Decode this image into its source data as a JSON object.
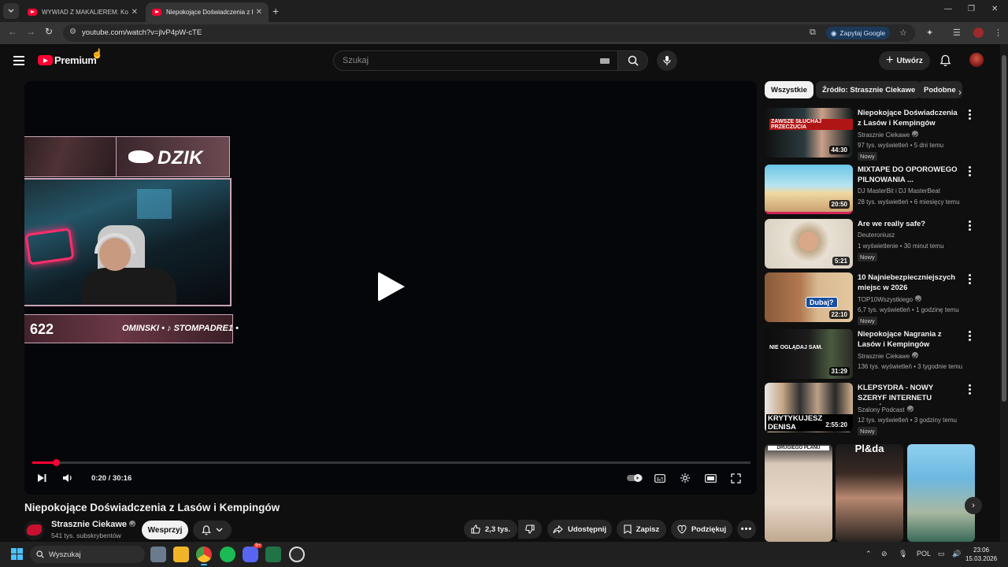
{
  "browser": {
    "tabs": [
      {
        "title": "WYWIAD Z MAKALIEREM: Kon",
        "active": false
      },
      {
        "title": "Niepokojące Doświadczenia z L",
        "active": true
      }
    ],
    "url": "youtube.com/watch?v=jlvP4pW-cTE",
    "ask_google_label": "Zapytaj Google",
    "accent_color": "#ff0033"
  },
  "masthead": {
    "logo_text": "Premium",
    "search_placeholder": "Szukaj",
    "create_label": "Utwórz"
  },
  "player": {
    "overlay_brand": "DZIK",
    "overlay_number": "622",
    "overlay_socials": "OMINSKI • ♪ STOMPADRE1 •",
    "time": "0:20 / 30:16",
    "progress_fraction": 0.011
  },
  "video": {
    "title": "Niepokojące Doświadczenia z Lasów i Kempingów",
    "channel": "Strasznie Ciekawe",
    "subscribers": "541 tys. subskrybentów",
    "support_label": "Wesprzyj",
    "likes": "2,3 tys.",
    "share_label": "Udostępnij",
    "save_label": "Zapisz",
    "thanks_label": "Podziękuj"
  },
  "sidebar": {
    "chips": [
      "Wszystkie",
      "Źródło: Strasznie Ciekawe",
      "Podobne"
    ],
    "recommendations": [
      {
        "title": "Niepokojące Doświadczenia z Lasów i Kempingów",
        "channel": "Strasznie Ciekawe",
        "verified": true,
        "meta": "97 tys. wyświetleń • 5 dni temu",
        "badge": "Nowy",
        "duration": "44:30",
        "thumb_text": "ZAWSZE SŁUCHAJ PRZECZUCIA"
      },
      {
        "title": "MIXTAPE DO OPOROWEGO PILNOWANIA ...",
        "channel": "DJ MasterBit i DJ MasterBeat",
        "verified": false,
        "meta": "28 tys. wyświetleń • 6 miesięcy temu",
        "badge": "",
        "duration": "20:50",
        "thumb_text": ""
      },
      {
        "title": "Are we really safe?",
        "channel": "Deuteroniusz",
        "verified": false,
        "meta": "1 wyświetlenie • 30 minut temu",
        "badge": "Nowy",
        "duration": "5:21",
        "thumb_text": ""
      },
      {
        "title": "10 Najniebezpieczniejszych miejsc w 2026",
        "channel": "TOP10Wszystkiego",
        "verified": true,
        "meta": "6,7 tys. wyświetleń • 1 godzinę temu",
        "badge": "Nowy",
        "duration": "22:10",
        "thumb_text": "Dubaj?"
      },
      {
        "title": "Niepokojące Nagrania z Lasów i Kempingów",
        "channel": "Strasznie Ciekawe",
        "verified": true,
        "meta": "136 tys. wyświetleń • 3 tygodnie temu",
        "badge": "",
        "duration": "31:29",
        "thumb_text": "NIE OGLĄDAJ SAM."
      },
      {
        "title": "KLEPSYDRA - NOWY SZERYF INTERNETU (MAKÓWKA, GOL...",
        "channel": "Szalony Podcast",
        "verified": true,
        "meta": "12 tys. wyświetleń • 3 godziny temu",
        "badge": "Nowy",
        "duration": "2:55:20",
        "thumb_text": "KRYTYKUJESZ DENISA"
      }
    ],
    "shorts": [
      {
        "caption": "DRUGIEGO PLANU"
      },
      {
        "caption": "Pl&da"
      },
      {
        "caption": ""
      }
    ]
  },
  "taskbar": {
    "search_label": "Wyszukaj",
    "lang": "POL",
    "time": "23:06",
    "date": "15.03.2026",
    "discord_badge": "9+"
  }
}
